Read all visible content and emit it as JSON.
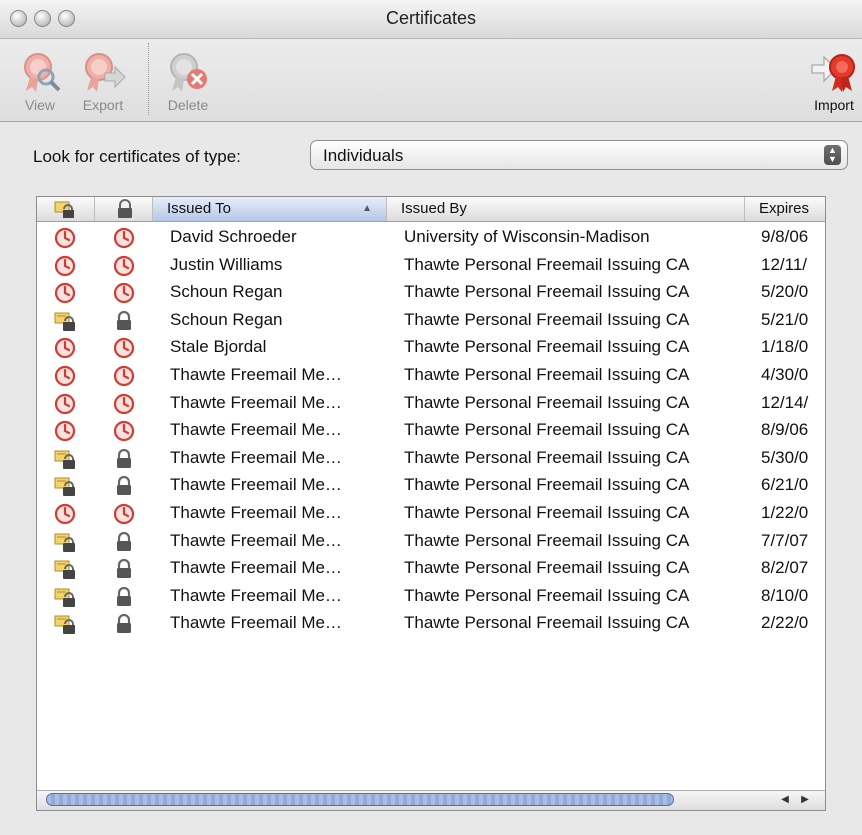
{
  "window": {
    "title": "Certificates"
  },
  "toolbar": {
    "view_label": "View",
    "export_label": "Export",
    "delete_label": "Delete",
    "import_label": "Import"
  },
  "filter": {
    "label": "Look for certificates of type:",
    "selected": "Individuals"
  },
  "table": {
    "columns": [
      "Issued To",
      "Issued By",
      "Expires"
    ],
    "rows": [
      {
        "status": "expired",
        "issued_to": "David Schroeder",
        "issued_by": "University of Wisconsin-Madison",
        "expires": "9/8/06"
      },
      {
        "status": "expired",
        "issued_to": "Justin Williams",
        "issued_by": "Thawte Personal Freemail Issuing CA",
        "expires": "12/11/"
      },
      {
        "status": "expired",
        "issued_to": "Schoun Regan",
        "issued_by": "Thawte Personal Freemail Issuing CA",
        "expires": "5/20/0"
      },
      {
        "status": "valid",
        "issued_to": "Schoun Regan",
        "issued_by": "Thawte Personal Freemail Issuing CA",
        "expires": "5/21/0"
      },
      {
        "status": "expired",
        "issued_to": "Stale Bjordal",
        "issued_by": "Thawte Personal Freemail Issuing CA",
        "expires": "1/18/0"
      },
      {
        "status": "expired",
        "issued_to": "Thawte Freemail Me…",
        "issued_by": "Thawte Personal Freemail Issuing CA",
        "expires": "4/30/0"
      },
      {
        "status": "expired",
        "issued_to": "Thawte Freemail Me…",
        "issued_by": "Thawte Personal Freemail Issuing CA",
        "expires": "12/14/"
      },
      {
        "status": "expired",
        "issued_to": "Thawte Freemail Me…",
        "issued_by": "Thawte Personal Freemail Issuing CA",
        "expires": "8/9/06"
      },
      {
        "status": "valid",
        "issued_to": "Thawte Freemail Me…",
        "issued_by": "Thawte Personal Freemail Issuing CA",
        "expires": "5/30/0"
      },
      {
        "status": "valid",
        "issued_to": "Thawte Freemail Me…",
        "issued_by": "Thawte Personal Freemail Issuing CA",
        "expires": "6/21/0"
      },
      {
        "status": "expired",
        "issued_to": "Thawte Freemail Me…",
        "issued_by": "Thawte Personal Freemail Issuing CA",
        "expires": "1/22/0"
      },
      {
        "status": "valid",
        "issued_to": "Thawte Freemail Me…",
        "issued_by": "Thawte Personal Freemail Issuing CA",
        "expires": "7/7/07"
      },
      {
        "status": "valid",
        "issued_to": "Thawte Freemail Me…",
        "issued_by": "Thawte Personal Freemail Issuing CA",
        "expires": "8/2/07"
      },
      {
        "status": "valid",
        "issued_to": "Thawte Freemail Me…",
        "issued_by": "Thawte Personal Freemail Issuing CA",
        "expires": "8/10/0"
      },
      {
        "status": "valid",
        "issued_to": "Thawte Freemail Me…",
        "issued_by": "Thawte Personal Freemail Issuing CA",
        "expires": "2/22/0"
      }
    ]
  },
  "icons": {
    "view": "certificate-view-icon",
    "export": "certificate-export-icon",
    "delete": "certificate-delete-icon",
    "import": "certificate-import-icon",
    "expired": "expired-clock-icon",
    "valid_key": "key-certificate-icon",
    "valid_lock": "padlock-icon"
  },
  "colors": {
    "expired_red": "#d23a32",
    "seal_red": "#e43a2c",
    "sort_header": "#b6c7e6"
  }
}
